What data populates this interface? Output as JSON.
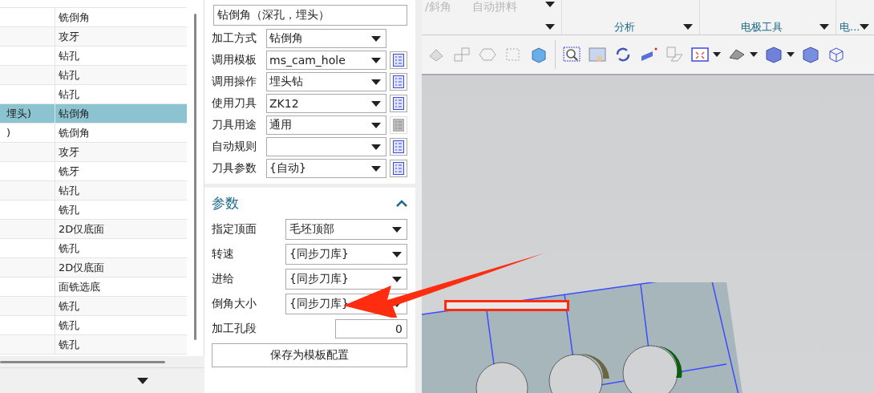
{
  "table": {
    "rows": [
      {
        "col1": "",
        "operation": "铣倒角",
        "selected": false
      },
      {
        "col1": "",
        "operation": "攻牙",
        "selected": false
      },
      {
        "col1": "",
        "operation": "钻孔",
        "selected": false
      },
      {
        "col1": "",
        "operation": "钻孔",
        "selected": false
      },
      {
        "col1": "",
        "operation": "钻孔",
        "selected": false
      },
      {
        "col1": "埋头)",
        "operation": "钻倒角",
        "selected": true
      },
      {
        "col1": ")",
        "operation": "铣倒角",
        "selected": false
      },
      {
        "col1": "",
        "operation": "攻牙",
        "selected": false
      },
      {
        "col1": "",
        "operation": "铣牙",
        "selected": false
      },
      {
        "col1": "",
        "operation": "钻孔",
        "selected": false
      },
      {
        "col1": "",
        "operation": "铣孔",
        "selected": false
      },
      {
        "col1": "",
        "operation": "2D仅底面",
        "selected": false
      },
      {
        "col1": "",
        "operation": "铣孔",
        "selected": false
      },
      {
        "col1": "",
        "operation": "2D仅底面",
        "selected": false
      },
      {
        "col1": "",
        "operation": "面铣选底",
        "selected": false
      },
      {
        "col1": "",
        "operation": "铣孔",
        "selected": false
      },
      {
        "col1": "",
        "operation": "铣孔",
        "selected": false
      },
      {
        "col1": "",
        "operation": "铣孔",
        "selected": false
      }
    ]
  },
  "form": {
    "title": "钻倒角（深孔，埋头）",
    "fields": [
      {
        "label": "加工方式",
        "value": "钻倒角"
      },
      {
        "label": "调用模板",
        "value": "ms_cam_hole",
        "list_button_enabled": true
      },
      {
        "label": "调用操作",
        "value": "埋头钻",
        "list_button_enabled": true
      },
      {
        "label": "使用刀具",
        "value": "ZK12",
        "list_button_enabled": true
      },
      {
        "label": "刀具用途",
        "value": "通用",
        "list_button_enabled": false
      },
      {
        "label": "自动规则",
        "list_button_enabled": true
      },
      {
        "label": "刀具参数",
        "value": "{自动}",
        "list_button_enabled": true
      }
    ]
  },
  "params": {
    "title": "参数",
    "expanded": true,
    "fields": [
      {
        "label": "指定顶面",
        "value": "毛坯顶部",
        "kind": "dropdown"
      },
      {
        "label": "转速",
        "value": "{同步刀库}",
        "kind": "dropdown"
      },
      {
        "label": "进给",
        "value": "{同步刀库}",
        "kind": "dropdown"
      },
      {
        "label": "倒角大小",
        "value": "{同步刀库}",
        "kind": "dropdown"
      },
      {
        "label": "加工孔段",
        "value": "0",
        "kind": "number"
      }
    ],
    "save_button": "保存为模板配置"
  },
  "ribbon": {
    "faded_items": [
      "/斜角",
      "自动拼料"
    ],
    "groups": [
      "分析",
      "电极工具",
      "电..."
    ]
  }
}
